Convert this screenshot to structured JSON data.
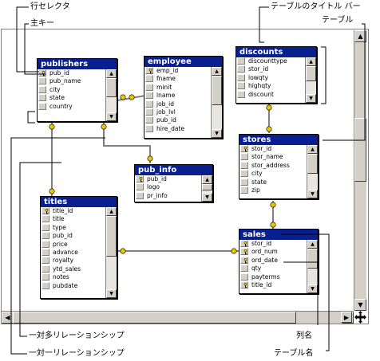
{
  "callouts": {
    "row_selector": "行セレクタ",
    "primary_key": "主キー",
    "title_bar": "テーブルのタイトル バー",
    "table": "テーブル",
    "one_to_many": "一対多リレーションシップ",
    "one_to_one": "一対一リレーションシップ",
    "column_name": "列名",
    "table_name": "テーブル名"
  },
  "tables": {
    "publishers": {
      "title": "publishers",
      "columns": [
        {
          "name": "pub_id",
          "key": true
        },
        {
          "name": "pub_name",
          "key": false
        },
        {
          "name": "city",
          "key": false
        },
        {
          "name": "state",
          "key": false
        },
        {
          "name": "country",
          "key": false
        }
      ]
    },
    "employee": {
      "title": "employee",
      "columns": [
        {
          "name": "emp_id",
          "key": true
        },
        {
          "name": "fname",
          "key": false
        },
        {
          "name": "minit",
          "key": false
        },
        {
          "name": "lname",
          "key": false
        },
        {
          "name": "job_id",
          "key": false
        },
        {
          "name": "job_lvl",
          "key": false
        },
        {
          "name": "pub_id",
          "key": false
        },
        {
          "name": "hire_date",
          "key": false
        }
      ]
    },
    "discounts": {
      "title": "discounts",
      "columns": [
        {
          "name": "discounttype",
          "key": false
        },
        {
          "name": "stor_id",
          "key": false
        },
        {
          "name": "lowqty",
          "key": false
        },
        {
          "name": "highqty",
          "key": false
        },
        {
          "name": "discount",
          "key": false
        }
      ]
    },
    "stores": {
      "title": "stores",
      "columns": [
        {
          "name": "stor_id",
          "key": true
        },
        {
          "name": "stor_name",
          "key": false
        },
        {
          "name": "stor_address",
          "key": false
        },
        {
          "name": "city",
          "key": false
        },
        {
          "name": "state",
          "key": false
        },
        {
          "name": "zip",
          "key": false
        }
      ]
    },
    "pub_info": {
      "title": "pub_info",
      "columns": [
        {
          "name": "pub_id",
          "key": true
        },
        {
          "name": "logo",
          "key": false
        },
        {
          "name": "pr_info",
          "key": false
        }
      ]
    },
    "titles": {
      "title": "titles",
      "columns": [
        {
          "name": "title_id",
          "key": true
        },
        {
          "name": "title",
          "key": false
        },
        {
          "name": "type",
          "key": false
        },
        {
          "name": "pub_id",
          "key": false
        },
        {
          "name": "price",
          "key": false
        },
        {
          "name": "advance",
          "key": false
        },
        {
          "name": "royalty",
          "key": false
        },
        {
          "name": "ytd_sales",
          "key": false
        },
        {
          "name": "notes",
          "key": false
        },
        {
          "name": "pubdate",
          "key": false
        }
      ]
    },
    "sales": {
      "title": "sales",
      "columns": [
        {
          "name": "stor_id",
          "key": true
        },
        {
          "name": "ord_num",
          "key": true
        },
        {
          "name": "ord_date",
          "key": true
        },
        {
          "name": "qty",
          "key": false
        },
        {
          "name": "payterms",
          "key": false
        },
        {
          "name": "title_id",
          "key": true
        }
      ]
    }
  },
  "colors": {
    "title_bar": "#0a1f8f",
    "relationship_line": "#808080",
    "key_marker": "#e8c800"
  },
  "icons": [
    "key-icon",
    "scroll-up-icon",
    "scroll-down-icon",
    "scroll-left-icon",
    "scroll-right-icon",
    "pan-move-icon",
    "infinity-end-icon",
    "key-end-icon"
  ]
}
